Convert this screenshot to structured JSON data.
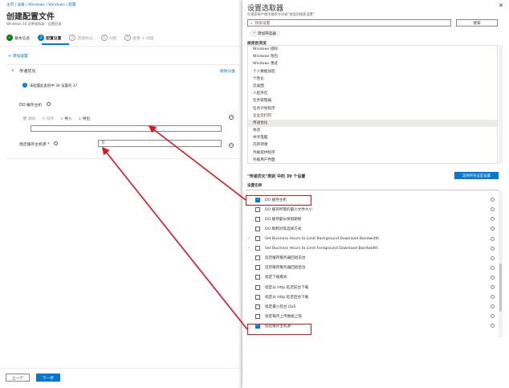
{
  "breadcrumb": "主页 | 设备 | Windows | Windows | 配置",
  "page": {
    "title": "创建配置文件",
    "subtitle": "Windows 10 及更高版本 - 设置目录"
  },
  "steps": [
    {
      "num": "✓",
      "label": "基本信息",
      "state": "done"
    },
    {
      "num": "2",
      "label": "配置设置",
      "state": "cur"
    },
    {
      "num": "3",
      "label": "范围标记",
      "state": "pend"
    },
    {
      "num": "4",
      "label": "分配",
      "state": "pend"
    },
    {
      "num": "5",
      "label": "查看 + 创建",
      "state": "pend"
    }
  ],
  "add_settings": "+ 添加设置",
  "section": {
    "title": "传递优化",
    "remove": "移除分类",
    "info": "未配置此类别中 39 设置的 37",
    "do_cache_host_label": "DO 缓存主机",
    "toolbar": {
      "delete": "删除",
      "replace": "排序",
      "import": "导入",
      "export": "导出"
    },
    "cache_source_label": "指定缓存主机源 *",
    "cache_source_value": "0"
  },
  "footer": {
    "prev": "上一个",
    "next": "下一步"
  },
  "picker": {
    "title": "设置选取器",
    "subtitle": "在搜索框中使用搜索字词或“按类别搜索设置”",
    "search_placeholder": "搜索设置",
    "search_button": "搜索",
    "add_filter": "添加筛选器",
    "browse_label": "按类别浏览",
    "categories": [
      "Windows 授权",
      "Windows 钱包",
      "Windows 墨迹",
      "个人数据加密",
      "个性化",
      "云桌面",
      "人脸存在",
      "任务管理器",
      "任务计划程序",
      "企业云打印",
      "传递优化",
      "体验",
      "共享电脑",
      "内存转储",
      "凭据提供程序",
      "凭据用户界面"
    ],
    "selected_category": "传递优化",
    "results_heading": "\"传递优化\"类别 中的 39 个设置",
    "select_all": "选择所有这些设置",
    "col_header": "设置名称",
    "settings": [
      {
        "label": "DO 缓存主机",
        "checked": true,
        "chevron": false
      },
      {
        "label": "DO 缓存所需的最小文件大小",
        "checked": false,
        "chevron": false
      },
      {
        "label": "DO 缓存最长保留期限",
        "checked": false,
        "chevron": false
      },
      {
        "label": "DO 限制对等选择方式",
        "checked": false,
        "chevron": false
      },
      {
        "label": "Set Business Hours to Limit Background Download Bandwidth",
        "checked": false,
        "chevron": true
      },
      {
        "label": "Set Business Hours to Limit Foreground Download Bandwidth",
        "checked": false,
        "chevron": true
      },
      {
        "label": "延迟缓存服务器回退前台",
        "checked": false,
        "chevron": false
      },
      {
        "label": "延迟缓存服务器回退后台",
        "checked": false,
        "chevron": false
      },
      {
        "label": "指定下载模式",
        "checked": false,
        "chevron": false
      },
      {
        "label": "指定从 Http 延迟前台下载",
        "checked": false,
        "chevron": false
      },
      {
        "label": "指定从 Http 延迟后台下载",
        "checked": false,
        "chevron": false
      },
      {
        "label": "指定最小后台 QoS",
        "checked": false,
        "chevron": false
      },
      {
        "label": "指定每月上传数据上限",
        "checked": false,
        "chevron": false
      },
      {
        "label": "指定缓存主机源",
        "checked": true,
        "chevron": false
      }
    ]
  }
}
